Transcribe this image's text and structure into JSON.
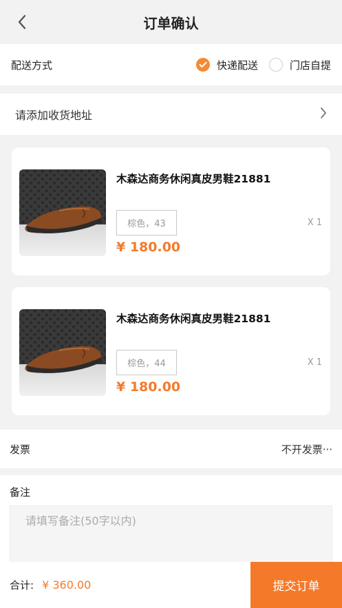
{
  "header": {
    "title": "订单确认"
  },
  "delivery": {
    "label": "配送方式",
    "options": [
      {
        "label": "快递配送",
        "selected": true
      },
      {
        "label": "门店自提",
        "selected": false
      }
    ]
  },
  "address": {
    "placeholder": "请添加收货地址"
  },
  "items": [
    {
      "name": "木森达商务休闲真皮男鞋21881",
      "spec": "棕色，43",
      "qty": "X 1",
      "price": "¥ 180.00"
    },
    {
      "name": "木森达商务休闲真皮男鞋21881",
      "spec": "棕色，44",
      "qty": "X 1",
      "price": "¥ 180.00"
    }
  ],
  "invoice": {
    "label": "发票",
    "value": "不开发票···"
  },
  "remarks": {
    "label": "备注",
    "placeholder": "请填写备注(50字以内)"
  },
  "footer": {
    "total_label": "合计:",
    "total_value": "¥ 360.00",
    "submit_label": "提交订单"
  },
  "colors": {
    "accent": "#f47a2a",
    "background": "#f2f2f2"
  }
}
